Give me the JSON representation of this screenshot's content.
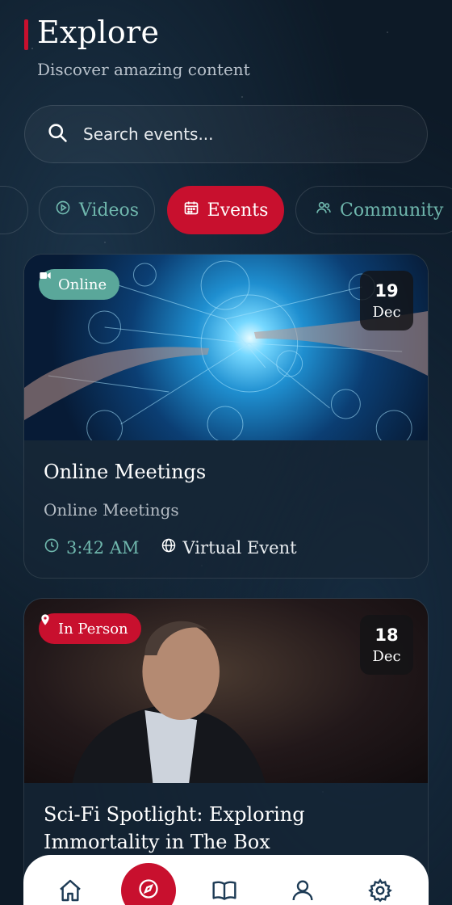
{
  "header": {
    "title": "Explore",
    "subtitle": "Discover amazing content"
  },
  "search": {
    "placeholder": "Search events..."
  },
  "tabs": [
    {
      "label": "Videos",
      "icon": "play-circle-icon",
      "active": false
    },
    {
      "label": "Events",
      "icon": "calendar-icon",
      "active": true
    },
    {
      "label": "Community",
      "icon": "users-icon",
      "active": false
    }
  ],
  "events": [
    {
      "badge": "Online",
      "badge_icon": "video-camera-icon",
      "day": "19",
      "month": "Dec",
      "title": "Online Meetings",
      "category": "Online Meetings",
      "time": "3:42 AM",
      "location": "Virtual Event"
    },
    {
      "badge": "In Person",
      "badge_icon": "map-pin-icon",
      "day": "18",
      "month": "Dec",
      "title": "Sci-Fi Spotlight: Exploring Immortality in The Box"
    }
  ],
  "nav": {
    "items": [
      "home-icon",
      "compass-icon",
      "book-icon",
      "user-icon",
      "settings-icon"
    ],
    "active": "compass-icon"
  },
  "colors": {
    "accent": "#c8102e",
    "teal": "#6fb7ad",
    "background": "#0d1a27"
  }
}
